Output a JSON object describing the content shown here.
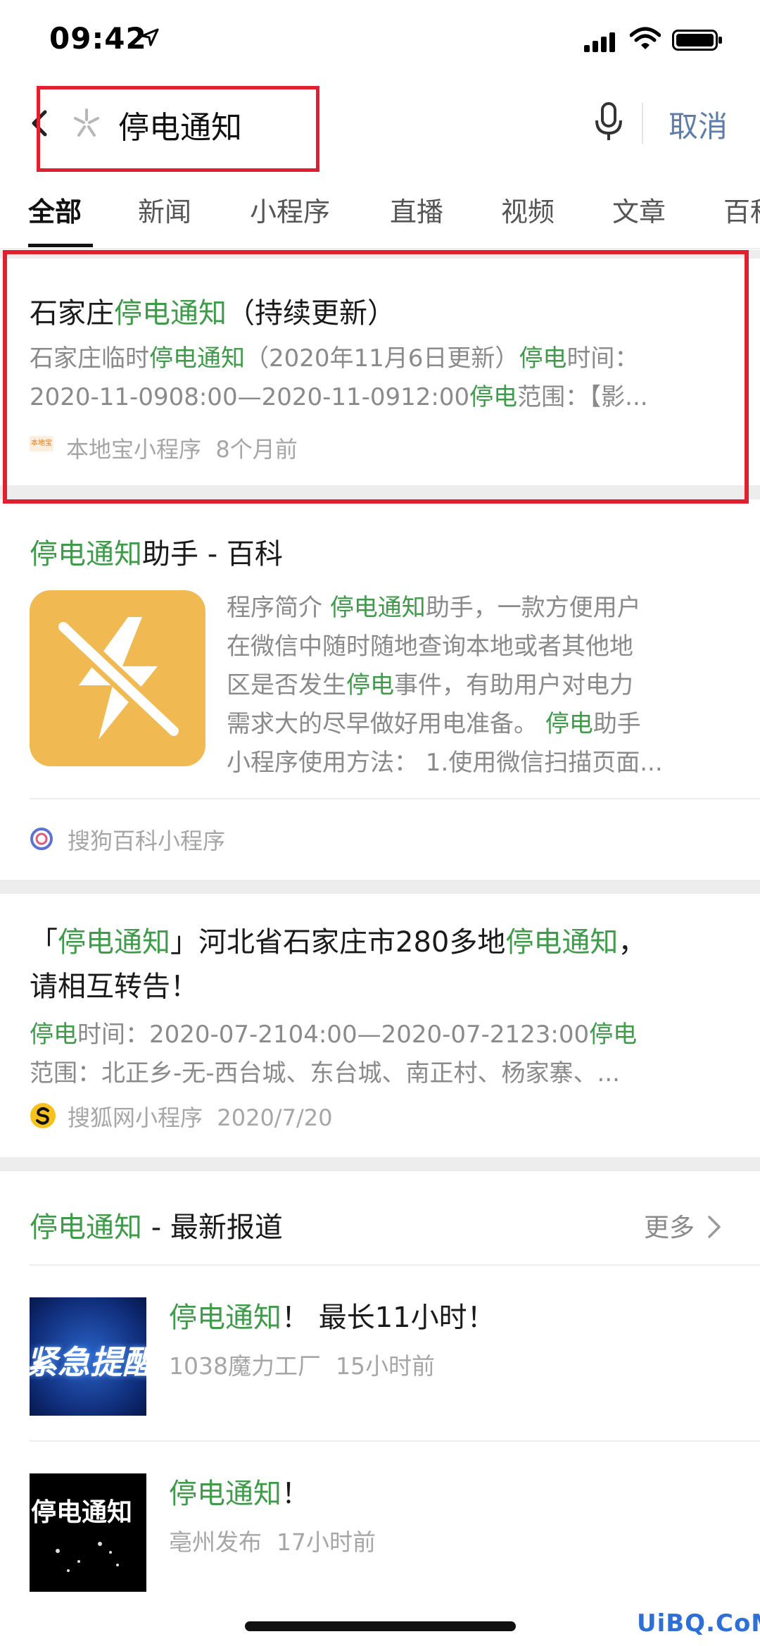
{
  "status_bar": {
    "time": "09:42"
  },
  "search": {
    "back_icon": "chevron-left-icon",
    "query": "停电通知",
    "cancel_label": "取消"
  },
  "tabs": [
    {
      "label": "全部",
      "active": true
    },
    {
      "label": "新闻"
    },
    {
      "label": "小程序"
    },
    {
      "label": "直播"
    },
    {
      "label": "视频"
    },
    {
      "label": "文章"
    },
    {
      "label": "百科"
    }
  ],
  "result1": {
    "title_pre": "石家庄",
    "title_hl": "停电通知",
    "title_post": "（持续更新）",
    "line1": {
      "a": "石家庄临时",
      "b": "停电通知",
      "c": "（2020年11月6日更新）",
      "d": "停电",
      "e": "时间："
    },
    "line2": {
      "a": "2020-11-0908:00—2020-11-0912:00",
      "b": "停电",
      "c": "范围：【影..."
    },
    "source": "本地宝小程序",
    "source_logo": "本地宝",
    "time": "8个月前"
  },
  "result2": {
    "title_hl": "停电通知",
    "title_post": "助手 - 百科",
    "desc": [
      {
        "a": "程序简介 ",
        "b": "停电通知",
        "c": "助手，一款方便用户"
      },
      {
        "a": "在微信中随时随地查询本地或者其他地"
      },
      {
        "a": "区是否发生",
        "b": "停电",
        "c": "事件，有助用户对电力"
      },
      {
        "a": "需求大的尽早做好用电准备。 ",
        "b": "停电",
        "c": "助手"
      },
      {
        "a": "小程序使用方法： 1.使用微信扫描页面..."
      }
    ],
    "source": "搜狗百科小程序"
  },
  "result3": {
    "title1": {
      "a": "「",
      "b": "停电通知",
      "c": "」河北省石家庄市280多地",
      "d": "停电通知",
      "e": "，"
    },
    "title2": "请相互转告！",
    "line1": {
      "a": "停电",
      "b": "时间：2020-07-2104:00—2020-07-2123:00",
      "c": "停电"
    },
    "line2": "范围：北正乡-无-西台城、东台城、南正村、杨家寨、...",
    "source": "搜狐网小程序",
    "date": "2020/7/20"
  },
  "news": {
    "header_hl": "停电通知",
    "header_post": " - 最新报道",
    "more_label": "更多",
    "items": [
      {
        "title_hl": "停电通知",
        "title_post": "！ 最长11小时！",
        "source": "1038魔力工厂",
        "time": "15小时前",
        "thumb_text": "紧急提醒"
      },
      {
        "title_hl": "停电通知",
        "title_post": "！",
        "source": "亳州发布",
        "time": "17小时前",
        "thumb_text": "停电通知"
      }
    ]
  },
  "watermark": "UiBQ.CoM",
  "colors": {
    "highlight": "#3f9b4a",
    "annotation_red": "#e1202f",
    "link_blue": "#5d7ea8"
  }
}
